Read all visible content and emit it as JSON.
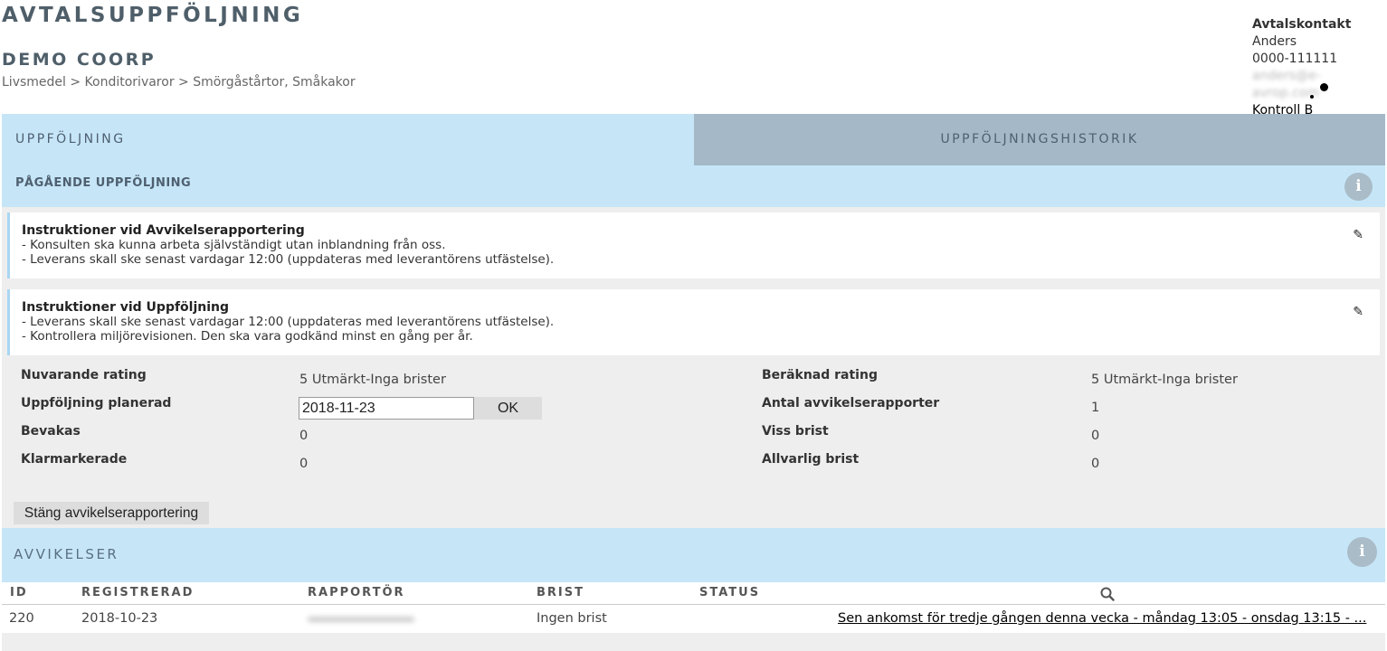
{
  "header": {
    "app_title": "AVTALSUPPFÖLJNING",
    "company": "DEMO COORP",
    "breadcrumb": "Livsmedel > Konditorivaror > Smörgåstårtor, Småkakor"
  },
  "contact": {
    "title": "Avtalskontakt",
    "name": "Anders",
    "phone": "0000-111111",
    "email": "anders@e-avrop.com",
    "link": "Kontroll B"
  },
  "tabs": [
    {
      "label": "UPPFÖLJNING"
    },
    {
      "label": "UPPFÖLJNINGSHISTORIK"
    }
  ],
  "ongoing": {
    "title": "PÅGÅENDE UPPFÖLJNING"
  },
  "instructions": [
    {
      "title": "Instruktioner vid Avvikelserapportering",
      "lines": [
        "- Konsulten ska kunna arbeta självständigt utan inblandning från oss.",
        "- Leverans skall ske senast vardagar 12:00 (uppdateras med leverantörens utfästelse)."
      ]
    },
    {
      "title": "Instruktioner vid Uppföljning",
      "lines": [
        "- Leverans skall ske senast vardagar 12:00 (uppdateras med leverantörens utfästelse).",
        "- Kontrollera miljörevisionen. Den ska vara godkänd minst en gång per år."
      ]
    }
  ],
  "fields": {
    "current_rating": {
      "label": "Nuvarande rating",
      "value": "5 Utmärkt-Inga brister"
    },
    "planned": {
      "label": "Uppföljning planerad",
      "value": "2018-11-23",
      "ok": "OK"
    },
    "watching": {
      "label": "Bevakas",
      "value": "0"
    },
    "cleared": {
      "label": "Klarmarkerade",
      "value": "0"
    },
    "computed_rating": {
      "label": "Beräknad rating",
      "value": "5 Utmärkt-Inga brister"
    },
    "report_count": {
      "label": "Antal avvikelserapporter",
      "value": "1"
    },
    "some_flaw": {
      "label": "Viss brist",
      "value": "0"
    },
    "serious_flaw": {
      "label": "Allvarlig brist",
      "value": "0"
    }
  },
  "close_button": "Stäng avvikelserapportering",
  "deviations": {
    "title": "AVVIKELSER",
    "columns": [
      "ID",
      "REGISTRERAD",
      "RAPPORTÖR",
      "BRIST",
      "STATUS"
    ],
    "rows": [
      {
        "id": "220",
        "registered": "2018-10-23",
        "reporter": "",
        "flaw": "Ingen brist",
        "status": "",
        "description": "Sen ankomst för tredje gången denna vecka - måndag 13:05 - onsdag 13:15 - ..."
      }
    ]
  }
}
